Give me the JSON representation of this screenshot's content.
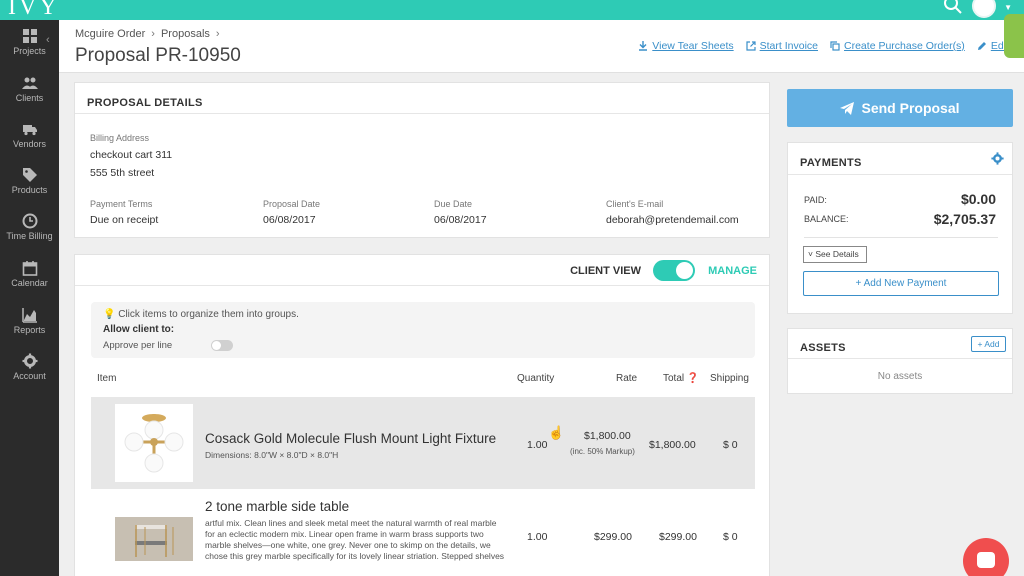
{
  "app": {
    "logo_text": "IVY"
  },
  "sidebar": {
    "items": [
      {
        "label": "Projects",
        "icon": "grid-icon"
      },
      {
        "label": "Clients",
        "icon": "people-icon"
      },
      {
        "label": "Vendors",
        "icon": "truck-icon"
      },
      {
        "label": "Products",
        "icon": "tag-icon"
      },
      {
        "label": "Time Billing",
        "icon": "clock-icon"
      },
      {
        "label": "Calendar",
        "icon": "calendar-icon"
      },
      {
        "label": "Reports",
        "icon": "chart-icon"
      },
      {
        "label": "Account",
        "icon": "gear-icon"
      }
    ]
  },
  "header": {
    "breadcrumb": [
      "Mcguire Order",
      "Proposals"
    ],
    "title": "Proposal PR-10950",
    "actions": [
      "View Tear Sheets",
      "Start Invoice",
      "Create Purchase Order(s)",
      "Edi"
    ]
  },
  "details": {
    "title": "PROPOSAL DETAILS",
    "billing_label": "Billing Address",
    "billing_line1": "checkout cart 311",
    "billing_line2": "555 5th street",
    "terms_label": "Payment Terms",
    "terms_value": "Due on receipt",
    "date_label": "Proposal Date",
    "date_value": "06/08/2017",
    "due_label": "Due Date",
    "due_value": "06/08/2017",
    "email_label": "Client's E-mail",
    "email_value": "deborah@pretendemail.com"
  },
  "items": {
    "client_view_label": "CLIENT VIEW",
    "client_view_on": true,
    "manage_label": "MANAGE",
    "hint": "Click items to organize them into groups.",
    "allow_label": "Allow client to:",
    "approve_label": "Approve per line",
    "columns": {
      "item": "Item",
      "quantity": "Quantity",
      "rate": "Rate",
      "total": "Total",
      "shipping": "Shipping"
    },
    "rows": [
      {
        "name": "Cosack Gold Molecule Flush Mount Light Fixture",
        "dimensions": "Dimensions: 8.0\"W × 8.0\"D × 8.0\"H",
        "quantity": "1.00",
        "rate": "$1,800.00",
        "markup": "(inc. 50% Markup)",
        "total": "$1,800.00",
        "shipping": "$ 0"
      },
      {
        "name": "2 tone marble side table",
        "description": "artful mix. Clean lines and sleek metal meet the natural warmth of real marble for an eclectic modern mix. Linear open frame in warm brass supports two marble shelves—one white, one grey. Never one to skimp on the details, we chose this grey marble specifically for its lovely linear striation. Stepped shelves let you display in layers with plenty of room left for a drink. (Coasters please.)",
        "quantity": "1.00",
        "rate": "$299.00",
        "total": "$299.00",
        "shipping": "$ 0"
      }
    ]
  },
  "send": {
    "label": "Send Proposal"
  },
  "payments": {
    "title": "PAYMENTS",
    "paid_label": "PAID:",
    "paid_value": "$0.00",
    "balance_label": "BALANCE:",
    "balance_value": "$2,705.37",
    "see_details_label": "See Details",
    "add_payment_label": "+ Add New Payment"
  },
  "assets": {
    "title": "ASSETS",
    "add_label": "+ Add",
    "empty_label": "No assets"
  },
  "colors": {
    "accent": "#2ecbb5",
    "link": "#3a8fc9",
    "send": "#63b0e3",
    "sidebar": "#2b2b2b",
    "chat": "#f04e4e"
  }
}
